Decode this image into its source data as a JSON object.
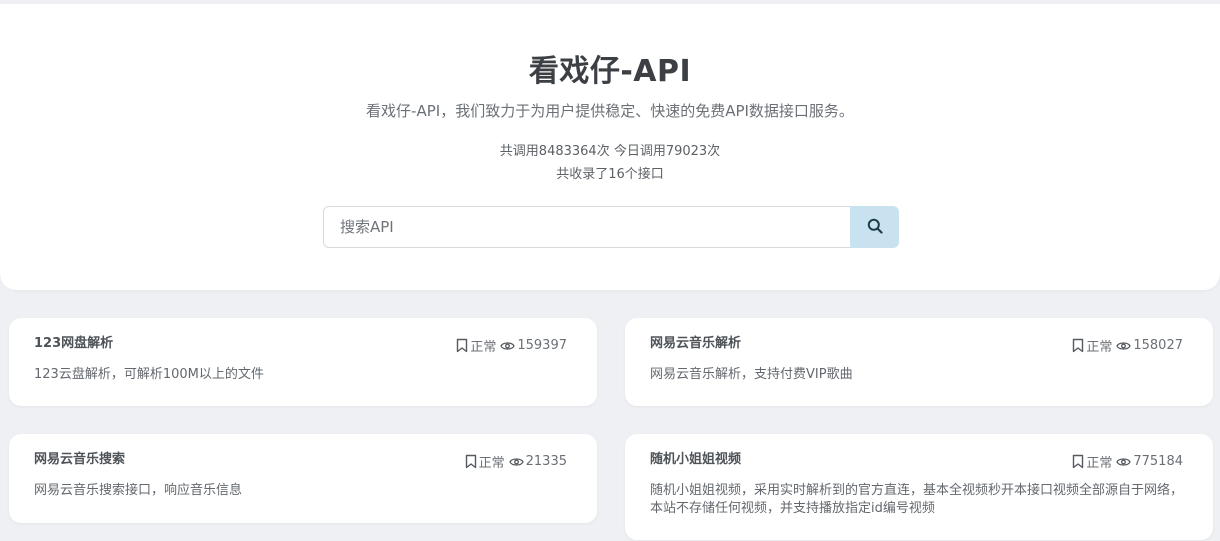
{
  "header": {
    "title": "看戏仔-API",
    "description": "看戏仔-API，我们致力于为用户提供稳定、快速的免费API数据接口服务。",
    "stats_line": "共调用8483364次 今日调用79023次",
    "count_line": "共收录了16个接口"
  },
  "search": {
    "placeholder": "搜索API",
    "button_icon": "search-icon"
  },
  "apis": [
    {
      "title": "123网盘解析",
      "status": "正常",
      "views": "159397",
      "description": "123云盘解析，可解析100M以上的文件"
    },
    {
      "title": "网易云音乐解析",
      "status": "正常",
      "views": "158027",
      "description": "网易云音乐解析，支持付费VIP歌曲"
    },
    {
      "title": "网易云音乐搜索",
      "status": "正常",
      "views": "21335",
      "description": "网易云音乐搜索接口，响应音乐信息"
    },
    {
      "title": "随机小姐姐视频",
      "status": "正常",
      "views": "775184",
      "description": "随机小姐姐视频，采用实时解析到的官方直连，基本全视频秒开本接口视频全部源自于网络，本站不存储任何视频，并支持播放指定id编号视频"
    }
  ],
  "icons": {
    "status": "bookmark-icon",
    "views": "eye-icon"
  },
  "colors": {
    "search_button_bg": "#c8e2f0",
    "page_bg": "#eef0f4"
  }
}
